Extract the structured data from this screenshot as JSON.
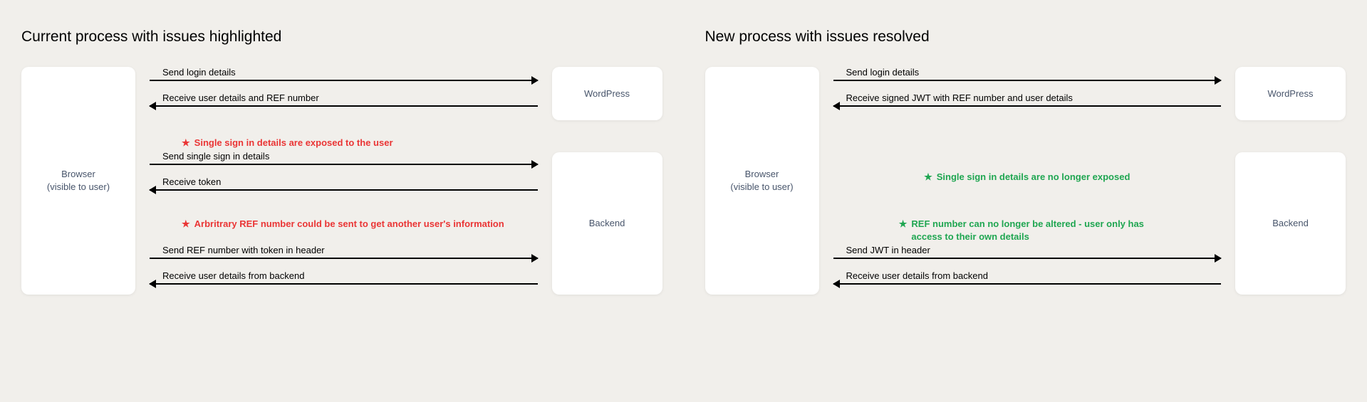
{
  "left": {
    "title": "Current process with issues highlighted",
    "browser_label": "Browser\n(visible to user)",
    "wordpress_label": "WordPress",
    "backend_label": "Backend",
    "arrows": {
      "a1": "Send login details",
      "a2": "Receive user details and REF number",
      "note1": "Single sign in details are exposed to the user",
      "a3": "Send single sign in details",
      "a4": "Receive token",
      "note2": "Arbritrary REF number could be sent to get another user's information",
      "a5": "Send REF number with token in header",
      "a6": "Receive user details from backend"
    }
  },
  "right": {
    "title": "New process with issues resolved",
    "browser_label": "Browser\n(visible to user)",
    "wordpress_label": "WordPress",
    "backend_label": "Backend",
    "arrows": {
      "a1": "Send login details",
      "a2": "Receive signed JWT with REF number and user details",
      "note1": "Single sign in details are no longer exposed",
      "note2": "REF number can no longer be altered - user only has access to their own details",
      "a5": "Send JWT in header",
      "a6": "Receive user details from backend"
    }
  },
  "star": "★"
}
